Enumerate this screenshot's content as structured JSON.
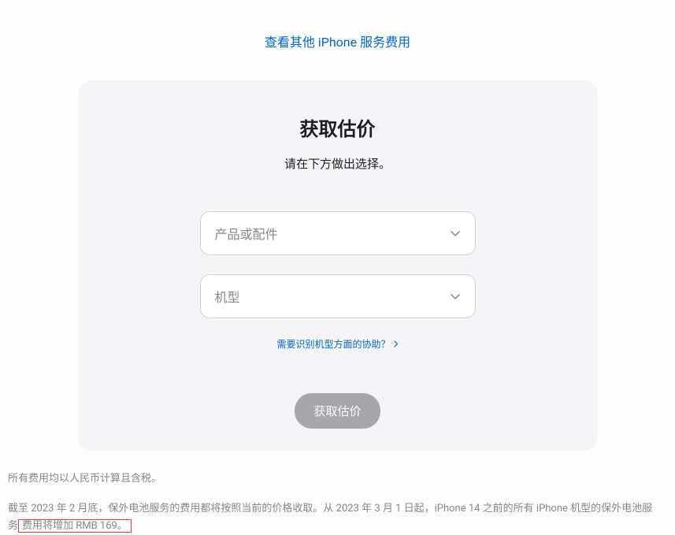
{
  "topLink": "查看其他 iPhone 服务费用",
  "card": {
    "title": "获取估价",
    "subtitle": "请在下方做出选择。",
    "select1": {
      "placeholder": "产品或配件"
    },
    "select2": {
      "placeholder": "机型"
    },
    "helpLink": "需要识别机型方面的协助？",
    "submitLabel": "获取估价"
  },
  "footer": {
    "line1": "所有费用均以人民币计算且含税。",
    "line2a": "截至 2023 年 2 月底，保外电池服务的费用都将按照当前的价格收取。从 2023 年 3 月 1 日起，iPhone 14 之前的所有 iPhone 机型的保外电池服务",
    "line2b": "费用将增加 RMB 169。"
  }
}
